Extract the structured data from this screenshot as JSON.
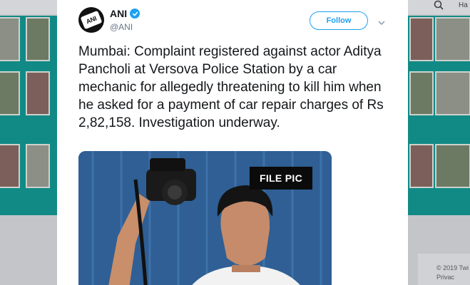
{
  "background": {
    "search_icon": "search-icon",
    "topbar_text": "Ha",
    "footer_line1": "© 2019 Twi",
    "footer_line2": "Privac"
  },
  "tweet": {
    "author_name": "ANI",
    "author_handle": "@ANI",
    "avatar_text": "ANI",
    "verified_icon": "verified-badge-icon",
    "follow_label": "Follow",
    "more_icon": "chevron-down-icon",
    "text": "Mumbai: Complaint registered against actor Aditya Pancholi at Versova Police Station by a car mechanic for allegedly threatening to kill him when he asked for a payment of car repair charges of Rs 2,82,158. Investigation underway.",
    "media_label": "FILE PIC"
  },
  "colors": {
    "accent": "#1da1f2",
    "text": "#14171a",
    "muted": "#657786"
  }
}
